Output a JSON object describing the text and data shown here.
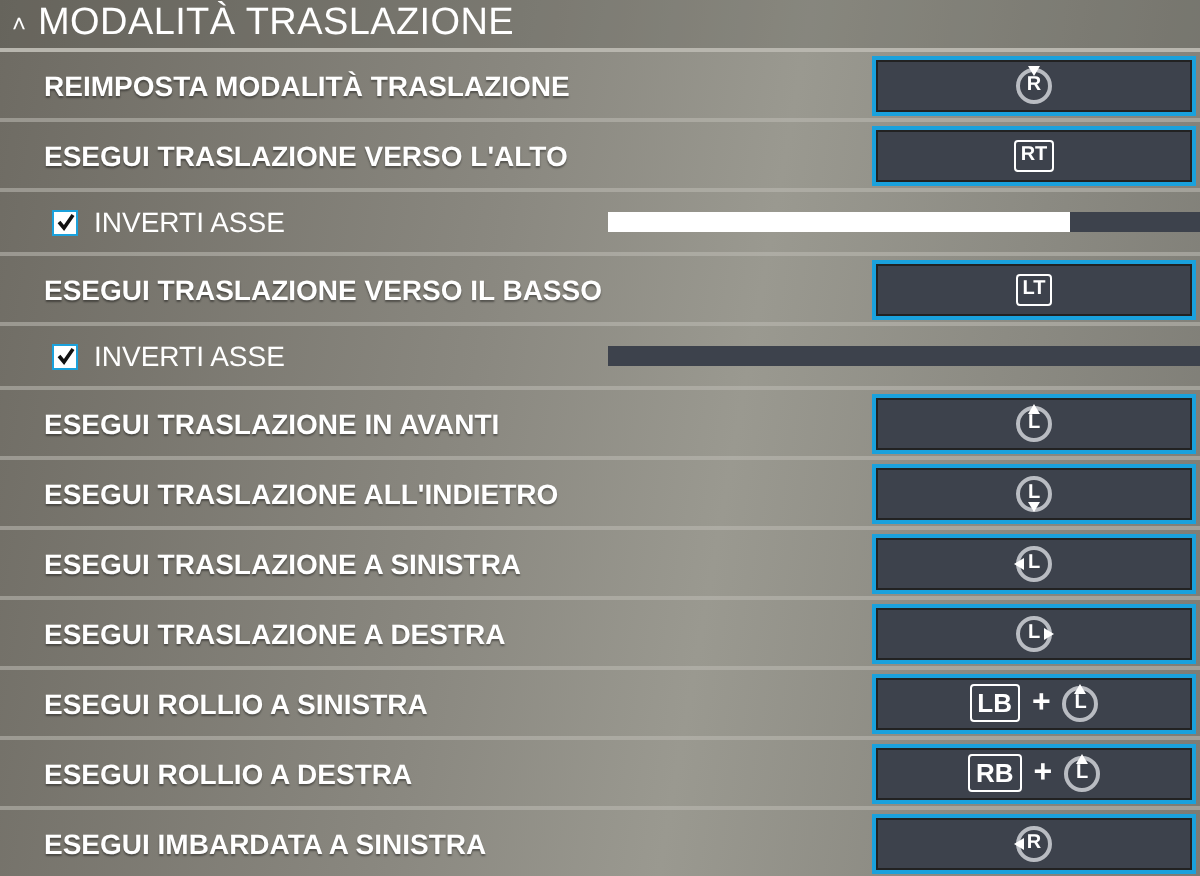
{
  "section": {
    "title": "MODALITÀ TRASLAZIONE",
    "expanded": true,
    "toggle": "˄"
  },
  "rows": [
    {
      "kind": "binding",
      "label": "REIMPOSTA MODALITÀ TRASLAZIONE",
      "keys": [
        {
          "kind": "stickpress",
          "text": "R"
        }
      ]
    },
    {
      "kind": "binding",
      "label": "ESEGUI TRASLAZIONE VERSO L'ALTO",
      "keys": [
        {
          "kind": "button",
          "text": "RT"
        }
      ]
    },
    {
      "kind": "invert",
      "label": "INVERTI ASSE",
      "checked": true,
      "level": 0.78
    },
    {
      "kind": "binding",
      "label": "ESEGUI TRASLAZIONE VERSO IL BASSO",
      "keys": [
        {
          "kind": "button",
          "text": "LT"
        }
      ]
    },
    {
      "kind": "invert",
      "label": "INVERTI ASSE",
      "checked": true,
      "level": 0
    },
    {
      "kind": "binding",
      "label": "ESEGUI TRASLAZIONE IN AVANTI",
      "keys": [
        {
          "kind": "stickup",
          "text": "L"
        }
      ]
    },
    {
      "kind": "binding",
      "label": "ESEGUI TRASLAZIONE ALL'INDIETRO",
      "keys": [
        {
          "kind": "stickdown",
          "text": "L"
        }
      ]
    },
    {
      "kind": "binding",
      "label": "ESEGUI TRASLAZIONE A SINISTRA",
      "keys": [
        {
          "kind": "stickleft",
          "text": "L"
        }
      ]
    },
    {
      "kind": "binding",
      "label": "ESEGUI TRASLAZIONE A DESTRA",
      "keys": [
        {
          "kind": "stickright",
          "text": "L"
        }
      ]
    },
    {
      "kind": "binding",
      "label": "ESEGUI ROLLIO A SINISTRA",
      "keys": [
        {
          "kind": "button",
          "text": "LB"
        },
        {
          "kind": "plus",
          "text": "+"
        },
        {
          "kind": "stickup",
          "text": "L"
        }
      ]
    },
    {
      "kind": "binding",
      "label": "ESEGUI ROLLIO A DESTRA",
      "keys": [
        {
          "kind": "button",
          "text": "RB"
        },
        {
          "kind": "plus",
          "text": "+"
        },
        {
          "kind": "stickup",
          "text": "L"
        }
      ]
    },
    {
      "kind": "binding",
      "label": "ESEGUI IMBARDATA A SINISTRA",
      "keys": [
        {
          "kind": "stickleft",
          "text": "R"
        }
      ]
    }
  ]
}
